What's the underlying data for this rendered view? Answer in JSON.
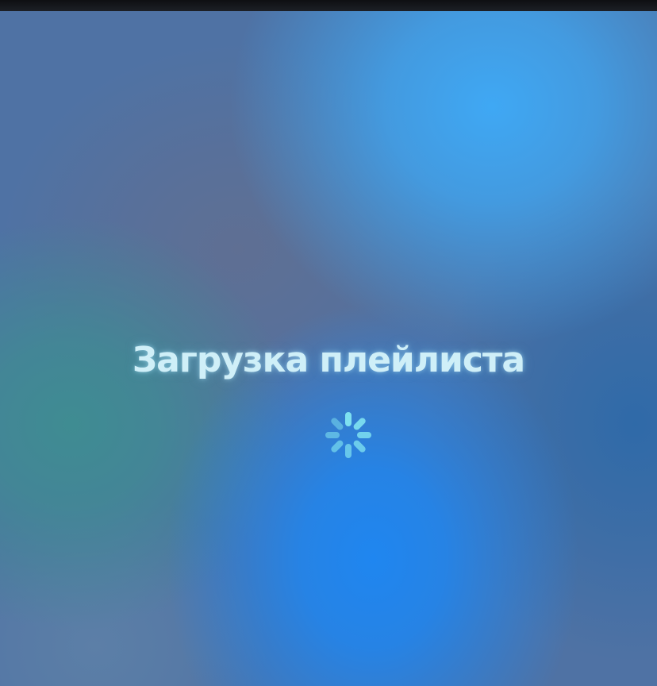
{
  "loading_screen": {
    "title": "Загрузка плейлиста",
    "spinner_icon": "activity-spinner-icon"
  },
  "colors": {
    "text": "#cfeff8",
    "spinner": "#7ee0f0",
    "accent_blue": "#1f86f0"
  }
}
